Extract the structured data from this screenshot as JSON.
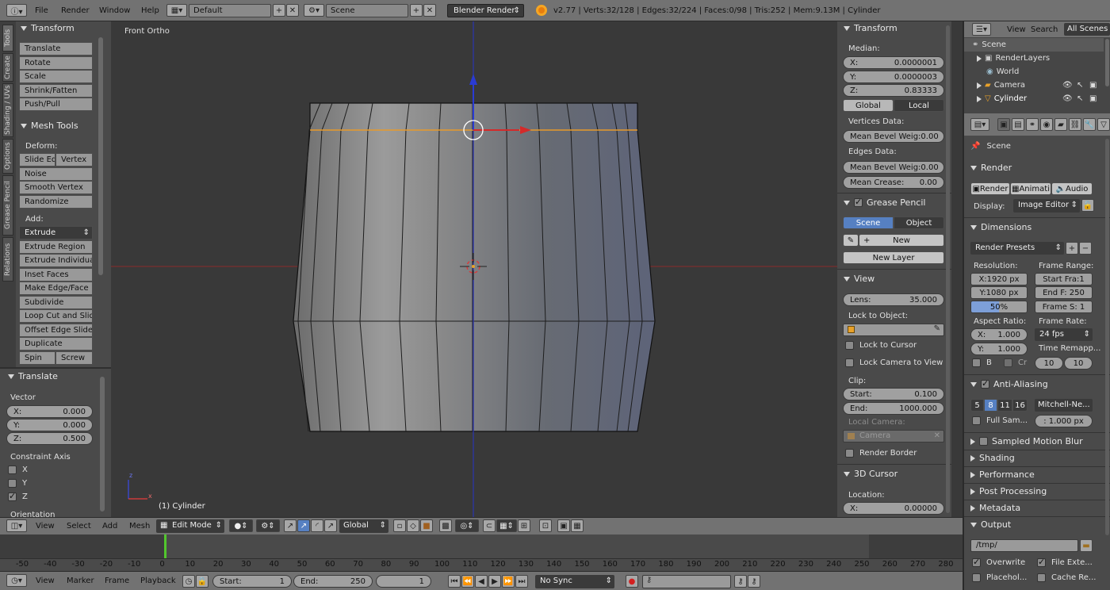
{
  "top_bar": {
    "menus": [
      "File",
      "Render",
      "Window",
      "Help"
    ],
    "layout": "Default",
    "scene": "Scene",
    "engine": "Blender Render",
    "stats": "v2.77 | Verts:32/128 | Edges:32/224 | Faces:0/98 | Tris:252 | Mem:9.13M | Cylinder"
  },
  "vertical_tabs": [
    "Tools",
    "Create",
    "Shading / UVs",
    "Options",
    "Grease Pencil",
    "Relations"
  ],
  "tool_shelf": {
    "transform": {
      "title": "Transform",
      "buttons": [
        "Translate",
        "Rotate",
        "Scale",
        "Shrink/Fatten",
        "Push/Pull"
      ]
    },
    "mesh_tools": {
      "title": "Mesh Tools",
      "deform_label": "Deform:",
      "slide_edge": "Slide Ed",
      "vertex": "Vertex",
      "deform_buttons": [
        "Noise",
        "Smooth Vertex",
        "Randomize"
      ],
      "add_label": "Add:",
      "extrude": "Extrude",
      "add_buttons": [
        "Extrude Region",
        "Extrude Individual",
        "Inset Faces",
        "Make Edge/Face",
        "Subdivide",
        "Loop Cut and Slide",
        "Offset Edge Slide",
        "Duplicate"
      ],
      "spin": "Spin",
      "screw": "Screw"
    }
  },
  "operator_panel": {
    "title": "Translate",
    "vector_label": "Vector",
    "x_label": "X:",
    "x": "0.000",
    "y_label": "Y:",
    "y": "0.000",
    "z_label": "Z:",
    "z": "0.500",
    "constraint_label": "Constraint Axis",
    "axes": [
      {
        "name": "X",
        "on": false
      },
      {
        "name": "Y",
        "on": false
      },
      {
        "name": "Z",
        "on": true
      }
    ],
    "orientation_label": "Orientation"
  },
  "viewport": {
    "view_name": "Front Ortho",
    "object_label": "(1) Cylinder",
    "axis_z": "z",
    "axis_x": "x"
  },
  "properties_n": {
    "transform_title": "Transform",
    "median_label": "Median:",
    "x_label": "X:",
    "x": "0.0000001",
    "y_label": "Y:",
    "y": "0.0000003",
    "z_label": "Z:",
    "z": "0.83333",
    "global": "Global",
    "local": "Local",
    "vertices_data": "Vertices Data:",
    "bevel_vert_label": "Mean Bevel Weig:",
    "bevel_vert": "0.00",
    "edges_data": "Edges Data:",
    "bevel_edge_label": "Mean Bevel Weig:",
    "bevel_edge": "0.00",
    "crease_label": "Mean Crease:",
    "crease": "0.00",
    "grease_title": "Grease Pencil",
    "scene": "Scene",
    "object": "Object",
    "new": "New",
    "new_layer": "New Layer",
    "view_title": "View",
    "lens_label": "Lens:",
    "lens": "35.000",
    "lock_obj_label": "Lock to Object:",
    "lock_cursor": "Lock to Cursor",
    "lock_camera": "Lock Camera to View",
    "clip_label": "Clip:",
    "start_label": "Start:",
    "start": "0.100",
    "end_label": "End:",
    "end": "1000.000",
    "local_camera": "Local Camera:",
    "camera": "Camera",
    "render_border": "Render Border",
    "cursor_title": "3D Cursor",
    "location_label": "Location:",
    "cx_label": "X:",
    "cx": "0.00000"
  },
  "outliner": {
    "view": "View",
    "search": "Search",
    "all_scenes": "All Scenes",
    "items": [
      "Scene",
      "RenderLayers",
      "World",
      "Camera",
      "Cylinder"
    ]
  },
  "props_editor": {
    "scene": "Scene",
    "render_title": "Render",
    "render": "Render",
    "animation": "Animati",
    "audio": "Audio",
    "display_label": "Display:",
    "display": "Image Editor",
    "dimensions_title": "Dimensions",
    "presets": "Render Presets",
    "resolution_label": "Resolution:",
    "frame_range_label": "Frame Range:",
    "res_x": "X:1920 px",
    "start_frame": "Start Fra:1",
    "res_y": "Y:1080 px",
    "end_frame": "End F: 250",
    "res_pct": "50%",
    "frame_step": "Frame S: 1",
    "aspect_label": "Aspect Ratio:",
    "frame_rate_label": "Frame Rate:",
    "ax_label": "X:",
    "ax": "1.000",
    "fps": "24 fps",
    "ay_label": "Y:",
    "ay": "1.000",
    "time_remap": "Time Remapp...",
    "b": "B",
    "cr": "Cr",
    "tr_old": "10",
    "tr_new": "10",
    "aa_title": "Anti-Aliasing",
    "aa_samples": [
      "5",
      "8",
      "11",
      "16"
    ],
    "filter": "Mitchell-Ne...",
    "full_sample": "Full Sam...",
    "filter_size": ": 1.000 px",
    "motion_blur": "Sampled Motion Blur",
    "sections": [
      "Shading",
      "Performance",
      "Post Processing",
      "Metadata"
    ],
    "output_title": "Output",
    "output_path": "/tmp/",
    "overwrite": "Overwrite",
    "file_ext": "File Exte...",
    "placeholders": "Placehol...",
    "cache": "Cache Re..."
  },
  "view3d_header": {
    "menus": [
      "View",
      "Select",
      "Add",
      "Mesh"
    ],
    "mode": "Edit Mode",
    "orientation": "Global"
  },
  "timeline": {
    "ticks": [
      "-50",
      "-40",
      "-30",
      "-20",
      "-10",
      "0",
      "10",
      "20",
      "30",
      "40",
      "50",
      "60",
      "70",
      "80",
      "90",
      "100",
      "110",
      "120",
      "130",
      "140",
      "150",
      "160",
      "170",
      "180",
      "190",
      "200",
      "210",
      "220",
      "230",
      "240",
      "250",
      "260",
      "270",
      "280"
    ],
    "menus": [
      "View",
      "Marker",
      "Frame",
      "Playback"
    ],
    "start_label": "Start:",
    "start": "1",
    "end_label": "End:",
    "end": "250",
    "current": "1",
    "sync": "No Sync"
  }
}
